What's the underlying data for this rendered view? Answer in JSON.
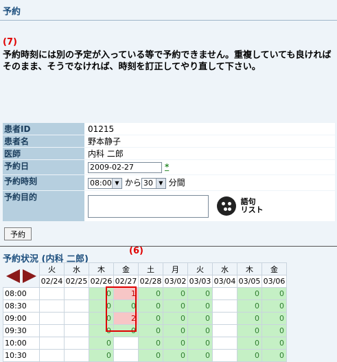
{
  "page_title": "予約",
  "step_message_number": "(7)",
  "message": "予約時刻には別の予定が入っている等で予約できません。重複していても良ければそのまま、そうでなければ、時刻を訂正してやり直して下さい。",
  "form": {
    "patient_id": {
      "label": "患者ID",
      "value": "01215"
    },
    "patient_name": {
      "label": "患者名",
      "value": "野本静子"
    },
    "doctor": {
      "label": "医師",
      "value": "内科 二郎"
    },
    "date": {
      "label": "予約日",
      "value": "2009-02-27",
      "asterisk": "*"
    },
    "time": {
      "label": "予約時刻",
      "hour": "08:00",
      "kara": "から",
      "minutes": "30",
      "unit": "分間"
    },
    "purpose": {
      "label": "予約目的",
      "value": "",
      "wordlist_line1": "語句",
      "wordlist_line2": "リスト"
    }
  },
  "reserve_button": "予約",
  "status": {
    "title": "予約状況 (内科 二郎)",
    "step_number": "(6)",
    "days": [
      "火",
      "水",
      "木",
      "金",
      "土",
      "月",
      "火",
      "水",
      "木",
      "金"
    ],
    "dates": [
      "02/24",
      "02/25",
      "02/26",
      "02/27",
      "02/28",
      "03/02",
      "03/03",
      "03/04",
      "03/05",
      "03/06"
    ],
    "rows": [
      {
        "time": "08:00",
        "cells": [
          "",
          "",
          "0",
          "1",
          "0",
          "0",
          "0",
          "",
          "0",
          "0"
        ]
      },
      {
        "time": "08:30",
        "cells": [
          "",
          "",
          "0",
          "0",
          "0",
          "0",
          "0",
          "",
          "0",
          "0"
        ]
      },
      {
        "time": "09:00",
        "cells": [
          "",
          "",
          "0",
          "2",
          "0",
          "0",
          "0",
          "",
          "0",
          "0"
        ]
      },
      {
        "time": "09:30",
        "cells": [
          "",
          "",
          "0",
          "0",
          "0",
          "0",
          "0",
          "",
          "0",
          "0"
        ]
      },
      {
        "time": "10:00",
        "cells": [
          "",
          "",
          "0",
          "",
          "0",
          "0",
          "0",
          "",
          "0",
          "0"
        ]
      },
      {
        "time": "10:30",
        "cells": [
          "",
          "",
          "0",
          "",
          "0",
          "0",
          "0",
          "",
          "0",
          "0"
        ]
      }
    ],
    "booked": [
      [
        0,
        3
      ],
      [
        2,
        3
      ]
    ]
  },
  "colors": {
    "available": "#c5f0c5",
    "booked": "#f7c6c6",
    "annotation": "#e00000"
  }
}
